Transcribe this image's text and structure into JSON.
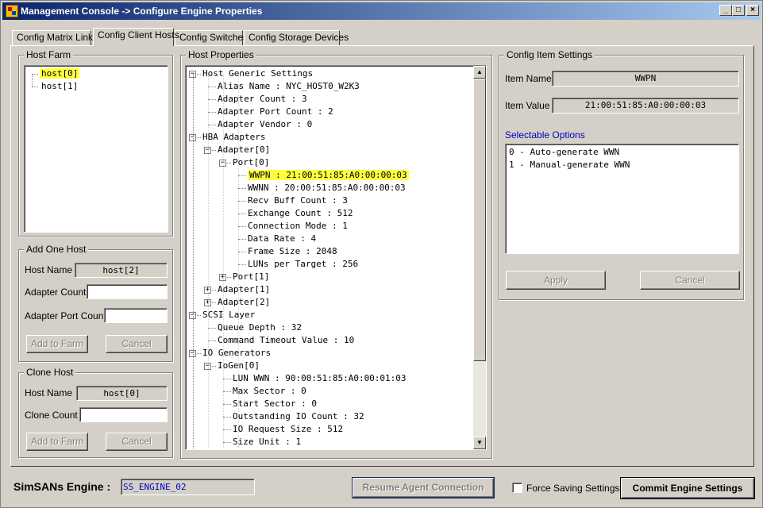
{
  "window": {
    "title": "Management Console -> Configure Engine Properties",
    "controls": {
      "minimize": "_",
      "maximize": "□",
      "close": "×"
    }
  },
  "tabs": [
    {
      "label": "Config Matrix Links",
      "active": false
    },
    {
      "label": "Config Client Hosts",
      "active": true
    },
    {
      "label": "Config Switches",
      "active": false
    },
    {
      "label": "Config Storage Devices",
      "active": false
    }
  ],
  "host_farm": {
    "title": "Host Farm",
    "items": [
      {
        "label": "host[0]",
        "selected": true
      },
      {
        "label": "host[1]",
        "selected": false
      }
    ]
  },
  "add_host": {
    "title": "Add One Host",
    "host_name_label": "Host Name",
    "host_name_value": "host[2]",
    "adapter_count_label": "Adapter Count",
    "adapter_count_value": "",
    "adapter_port_count_label": "Adapter Port Count",
    "adapter_port_count_value": "",
    "add_button": "Add to Farm",
    "cancel_button": "Cancel"
  },
  "clone_host": {
    "title": "Clone Host",
    "host_name_label": "Host Name",
    "host_name_value": "host[0]",
    "clone_count_label": "Clone Count",
    "clone_count_value": "",
    "add_button": "Add to Farm",
    "cancel_button": "Cancel"
  },
  "host_properties": {
    "title": "Host Properties",
    "rows": [
      {
        "text": "Host Generic Settings",
        "level": 0,
        "expander": "−"
      },
      {
        "text": "Alias Name : NYC_HOST0_W2K3",
        "level": 1
      },
      {
        "text": "Adapter Count : 3",
        "level": 1
      },
      {
        "text": "Adapter Port Count : 2",
        "level": 1
      },
      {
        "text": "Adapter Vendor : 0",
        "level": 1
      },
      {
        "text": "HBA Adapters",
        "level": 0,
        "expander": "−"
      },
      {
        "text": "Adapter[0]",
        "level": 1,
        "expander": "−"
      },
      {
        "text": "Port[0]",
        "level": 2,
        "expander": "−"
      },
      {
        "text": "WWPN : 21:00:51:85:A0:00:00:03",
        "level": 3,
        "highlight": true
      },
      {
        "text": "WWNN : 20:00:51:85:A0:00:00:03",
        "level": 3
      },
      {
        "text": "Recv Buff Count : 3",
        "level": 3
      },
      {
        "text": "Exchange Count : 512",
        "level": 3
      },
      {
        "text": "Connection Mode : 1",
        "level": 3
      },
      {
        "text": "Data Rate : 4",
        "level": 3
      },
      {
        "text": "Frame Size : 2048",
        "level": 3
      },
      {
        "text": "LUNs per Target : 256",
        "level": 3
      },
      {
        "text": "Port[1]",
        "level": 2,
        "expander": "+"
      },
      {
        "text": "Adapter[1]",
        "level": 1,
        "expander": "+"
      },
      {
        "text": "Adapter[2]",
        "level": 1,
        "expander": "+"
      },
      {
        "text": "SCSI Layer",
        "level": 0,
        "expander": "−"
      },
      {
        "text": "Queue Depth : 32",
        "level": 1
      },
      {
        "text": "Command Timeout Value : 10",
        "level": 1
      },
      {
        "text": "IO Generators",
        "level": 0,
        "expander": "−"
      },
      {
        "text": "IoGen[0]",
        "level": 1,
        "expander": "−"
      },
      {
        "text": "LUN WWN : 90:00:51:85:A0:00:01:03",
        "level": 2
      },
      {
        "text": "Max Sector : 0",
        "level": 2
      },
      {
        "text": "Start Sector : 0",
        "level": 2
      },
      {
        "text": "Outstanding IO Count : 32",
        "level": 2
      },
      {
        "text": "IO Request Size : 512",
        "level": 2
      },
      {
        "text": "Size Unit : 1",
        "level": 2
      }
    ]
  },
  "config_item": {
    "title": "Config Item Settings",
    "item_name_label": "Item Name",
    "item_name_value": "WWPN",
    "item_value_label": "Item Value",
    "item_value_value": "21:00:51:85:A0:00:00:03",
    "selectable_label": "Selectable Options",
    "options": [
      "0 - Auto-generate WWN",
      "1 - Manual-generate WWN"
    ],
    "apply_button": "Apply",
    "cancel_button": "Cancel"
  },
  "bottom": {
    "engine_label": "SimSANs Engine :",
    "engine_value": "SS_ENGINE_02",
    "resume_button": "Resume Agent Connection",
    "force_saving_label": "Force Saving Settings",
    "commit_button": "Commit Engine Settings"
  },
  "colors": {
    "highlight": "#ffff40",
    "selectable_label": "#0000c0",
    "engine_value": "#0000c0"
  }
}
